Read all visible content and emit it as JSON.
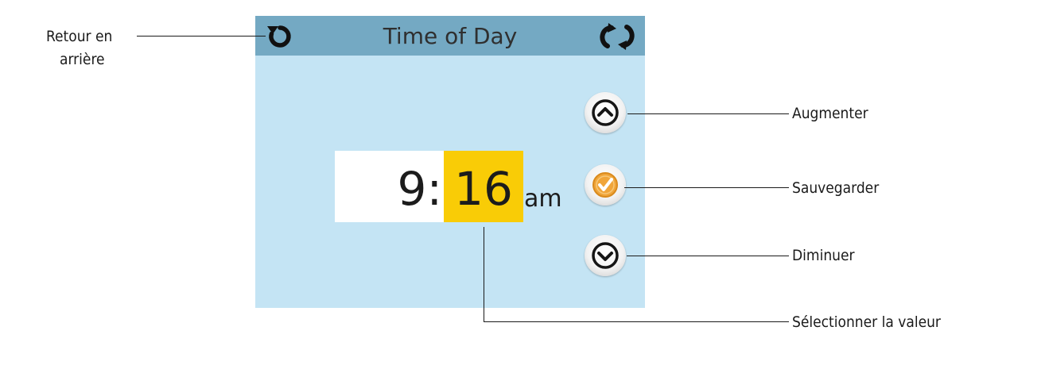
{
  "screen": {
    "title": "Time of Day",
    "back_icon": "back-arrow-icon",
    "refresh_icon": "refresh-icon"
  },
  "time": {
    "hour": "9:",
    "minute": "16",
    "meridiem": "am"
  },
  "buttons": {
    "up_icon": "chevron-up-icon",
    "save_icon": "checkmark-icon",
    "down_icon": "chevron-down-icon"
  },
  "callouts": {
    "back_line1": "Retour en",
    "back_line2": "arrière",
    "increase": "Augmenter",
    "save": "Sauvegarder",
    "decrease": "Diminuer",
    "select_value": "Sélectionner la valeur"
  },
  "colors": {
    "titlebar": "#74a9c3",
    "screen_background": "#c4e4f4",
    "selected_field": "#f9cc06",
    "save_button": "#f0a53a"
  }
}
